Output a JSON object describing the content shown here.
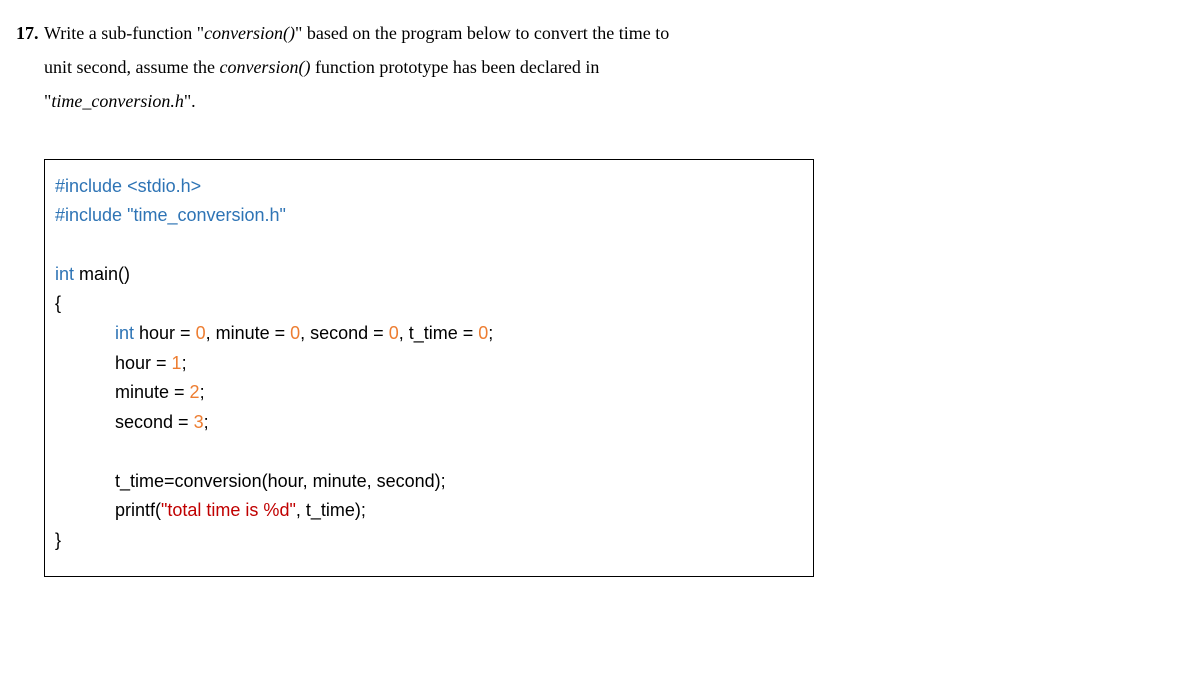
{
  "question": {
    "number": "17.",
    "line1_a": "Write a sub-function \"",
    "line1_italic": "conversion()",
    "line1_b": "\" based on the program below to convert the time to",
    "line2_a": "unit  second,  assume  the  ",
    "line2_italic": "conversion()",
    "line2_b": "  function  prototype  has  been  declared  in",
    "line3_a": "\"",
    "line3_italic": "time_conversion.h",
    "line3_b": "\"."
  },
  "code": {
    "l1a": "#include ",
    "l1b": "<stdio.h>",
    "l2a": "#include ",
    "l2b": "\"time_conversion.h\"",
    "l3a": "int",
    "l3b": " main()",
    "l4": "{",
    "l5a": "int",
    "l5b": " hour = ",
    "l5n0": "0",
    "l5c": ", minute = ",
    "l5d": ", second = ",
    "l5e": ", t_time = ",
    "l5f": ";",
    "l6a": "hour = ",
    "l6n": "1",
    "l6b": ";",
    "l7a": "minute = ",
    "l7n": "2",
    "l7b": ";",
    "l8a": "second = ",
    "l8n": "3",
    "l8b": ";",
    "l9": "t_time=conversion(hour, minute, second);",
    "l10a": "printf(",
    "l10s": "\"total time is %d\"",
    "l10b": ", t_time);",
    "l11": "}"
  }
}
